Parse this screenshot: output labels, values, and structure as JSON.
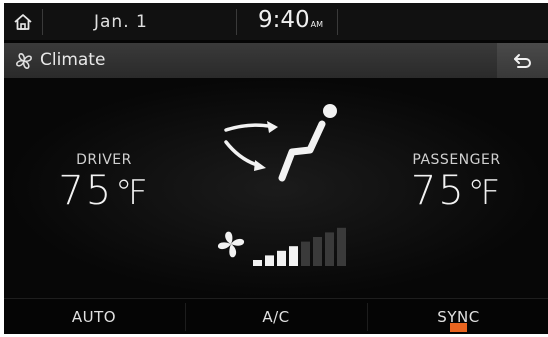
{
  "status_bar": {
    "date": "Jan.  1",
    "time": "9:40",
    "time_period": "AM"
  },
  "title_bar": {
    "title": "Climate"
  },
  "climate": {
    "driver": {
      "label": "DRIVER",
      "temperature": "75",
      "unit": "℉"
    },
    "passenger": {
      "label": "PASSENGER",
      "temperature": "75",
      "unit": "℉"
    },
    "fan_speed": {
      "level": 4,
      "max": 8
    }
  },
  "bottom_bar": {
    "auto_label": "AUTO",
    "ac_label": "A/C",
    "sync_label": "SYNC"
  },
  "colors": {
    "background": "#050505",
    "sync_indicator": "#e8641f"
  }
}
